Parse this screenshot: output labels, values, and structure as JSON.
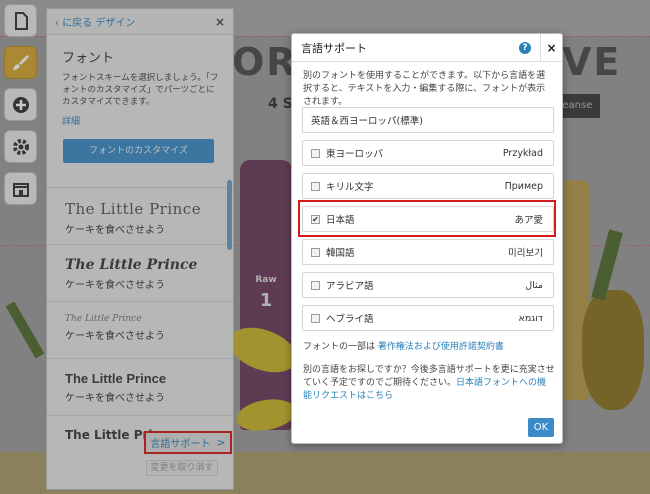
{
  "background": {
    "title_left": "ORI",
    "title_right": "VE",
    "subtitle": "4 S",
    "button_label": "leanse",
    "bottle_label": "Raw",
    "bottle_number": "1"
  },
  "toolbar": {
    "items": [
      {
        "name": "page-tool-button",
        "icon": "page-icon"
      },
      {
        "name": "design-tool-button",
        "icon": "paintbrush-icon",
        "active": true
      },
      {
        "name": "add-tool-button",
        "icon": "plus-icon"
      },
      {
        "name": "settings-tool-button",
        "icon": "gear-icon"
      },
      {
        "name": "store-tool-button",
        "icon": "store-icon"
      }
    ]
  },
  "panel": {
    "back_label": "に戻る デザイン",
    "close_label": "×",
    "title": "フォント",
    "description": "フォントスキームを選択しましょう。「フォントのカスタマイズ」でパーツごとにカスタマイズできます。",
    "details_link": "詳細",
    "customize_button": "フォントのカスタマイズ",
    "font_items": [
      {
        "sample": "The Little Prince",
        "jp": "ケーキを食べさせよう"
      },
      {
        "sample": "The Little Prince",
        "jp": "ケーキを食べさせよう"
      },
      {
        "sample": "The Little Prince",
        "jp": "ケーキを食べさせよう"
      },
      {
        "sample": "The Little Prince",
        "jp": "ケーキを食べさせよう"
      },
      {
        "sample": "The Little Prince",
        "jp": ""
      }
    ],
    "lang_support_link": "言語サポート",
    "lang_support_arrow": ">",
    "undo_button": "変更を取り消す"
  },
  "modal": {
    "title": "言語サポート",
    "help_label": "?",
    "close_label": "×",
    "description": "別のフォントを使用することができます。以下から言語を選択すると、テキストを入力・編集する際に、フォントが表示されます。",
    "languages": [
      {
        "name": "英語＆西ヨーロッパ(標準)",
        "sample": "",
        "has_checkbox": false,
        "checked": false
      },
      {
        "name": "東ヨーロッパ",
        "sample": "Przykład",
        "has_checkbox": true,
        "checked": false
      },
      {
        "name": "キリル文字",
        "sample": "Пример",
        "has_checkbox": true,
        "checked": false
      },
      {
        "name": "日本語",
        "sample": "あア愛",
        "has_checkbox": true,
        "checked": true
      },
      {
        "name": "韓国語",
        "sample": "미리보기",
        "has_checkbox": true,
        "checked": false
      },
      {
        "name": "アラビア語",
        "sample": "مثال",
        "has_checkbox": true,
        "checked": false
      },
      {
        "name": "ヘブライ語",
        "sample": "דוגמא",
        "has_checkbox": true,
        "checked": false
      }
    ],
    "note_prefix": "フォントの一部は",
    "note_link": "著作権法および使用許諾契約書",
    "note2_text": "別の言語をお探しですか？今後多言語サポートを更に充実させていく予定ですのでご期待ください。",
    "note2_link": "日本語フォントへの機能リクエストはこちら",
    "ok_button": "OK"
  },
  "colors": {
    "accent": "#3b8bc7",
    "highlight": "#d41a1a",
    "active_tool": "#d6a531"
  }
}
